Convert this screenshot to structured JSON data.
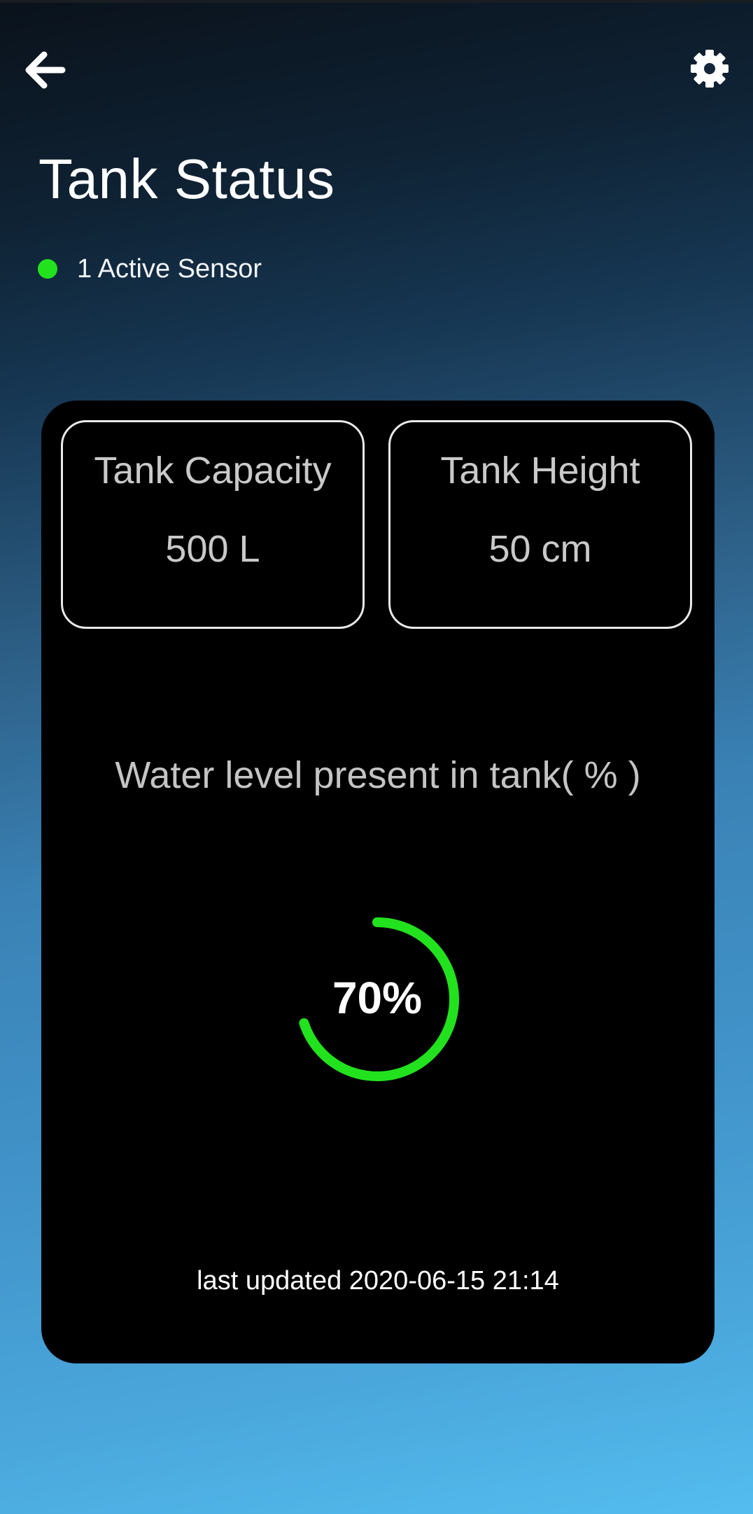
{
  "header": {
    "back_icon": "arrow-left-icon",
    "settings_icon": "gear-icon",
    "title": "Tank Status"
  },
  "sensor": {
    "label": "1 Active Sensor",
    "status_color": "#22e21e"
  },
  "tank": {
    "capacity_label": "Tank Capacity",
    "capacity_value": "500 L",
    "height_label": "Tank Height",
    "height_value": "50 cm"
  },
  "level": {
    "caption": "Water level present in tank( % )",
    "percent": 70,
    "percent_text": "70%",
    "gauge_color": "#22e21e"
  },
  "footer": {
    "updated": "last updated 2020-06-15 21:14"
  }
}
